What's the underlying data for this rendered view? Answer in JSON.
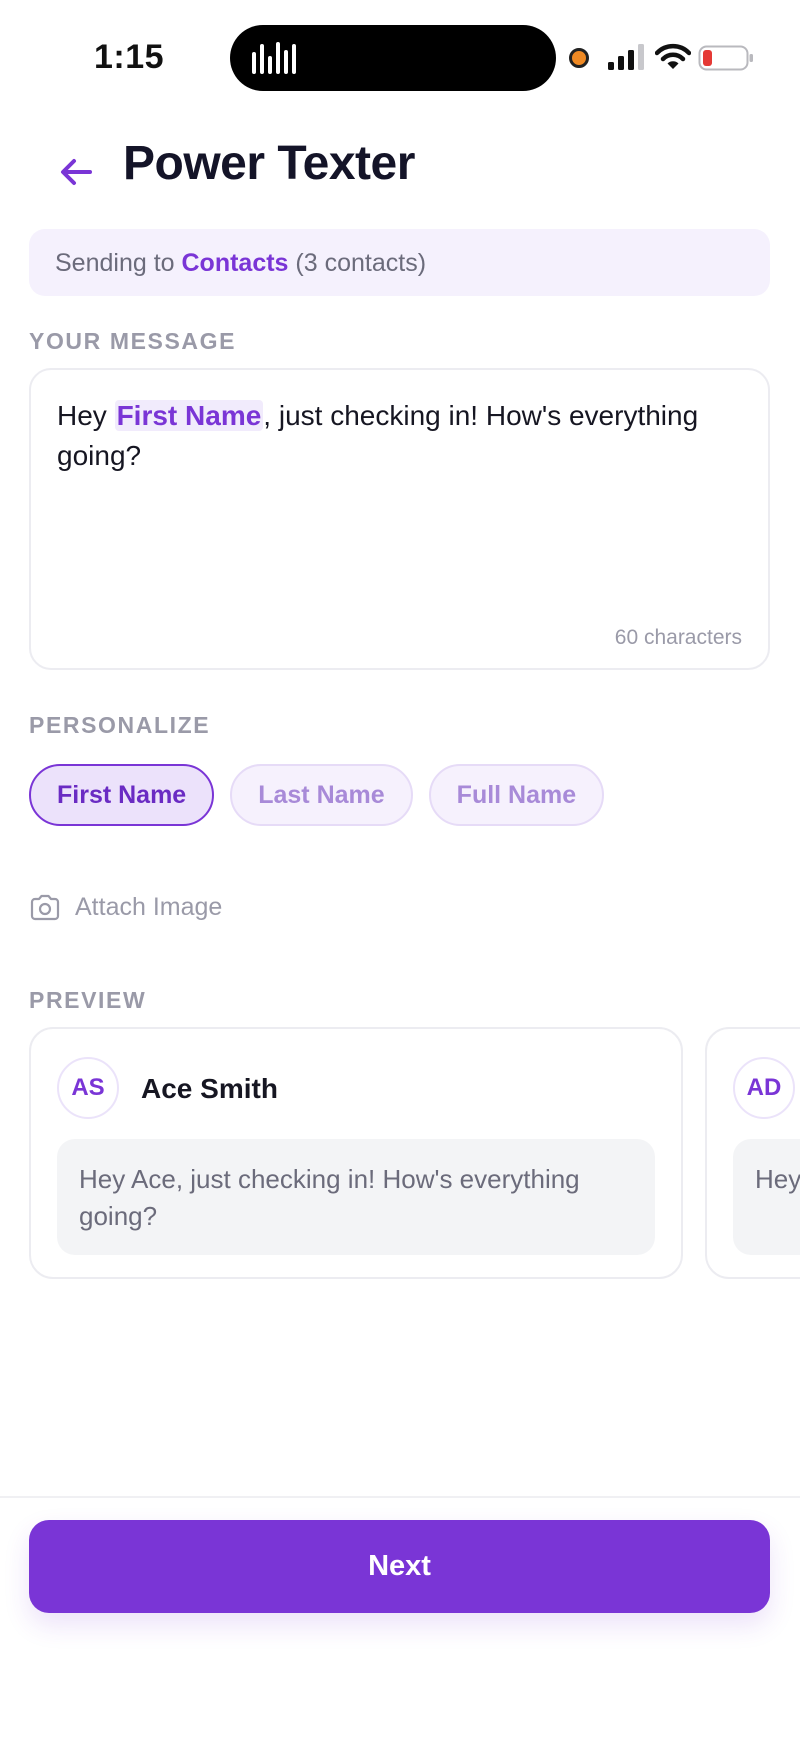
{
  "status_bar": {
    "time": "1:15"
  },
  "header": {
    "title": "Power Texter"
  },
  "banner": {
    "prefix": "Sending to ",
    "group": "Contacts",
    "suffix": " (3 contacts)"
  },
  "message": {
    "section_label": "YOUR MESSAGE",
    "before_token": "Hey ",
    "token": "First Name",
    "after_token": ", just checking in! How's everything going?",
    "char_count": "60 characters"
  },
  "personalize": {
    "section_label": "PERSONALIZE",
    "chips": [
      "First Name",
      "Last Name",
      "Full Name"
    ]
  },
  "attach": {
    "label": "Attach Image"
  },
  "preview": {
    "section_label": "PREVIEW",
    "cards": [
      {
        "initials": "AS",
        "name": "Ace Smith",
        "message": "Hey Ace, just checking in! How's everything going?"
      },
      {
        "initials": "AD",
        "name": "",
        "message": "Hey going?"
      }
    ]
  },
  "footer": {
    "next_label": "Next"
  },
  "colors": {
    "accent": "#7a35d6",
    "banner_bg": "#f5f1fd",
    "bubble_bg": "#f3f4f6"
  }
}
